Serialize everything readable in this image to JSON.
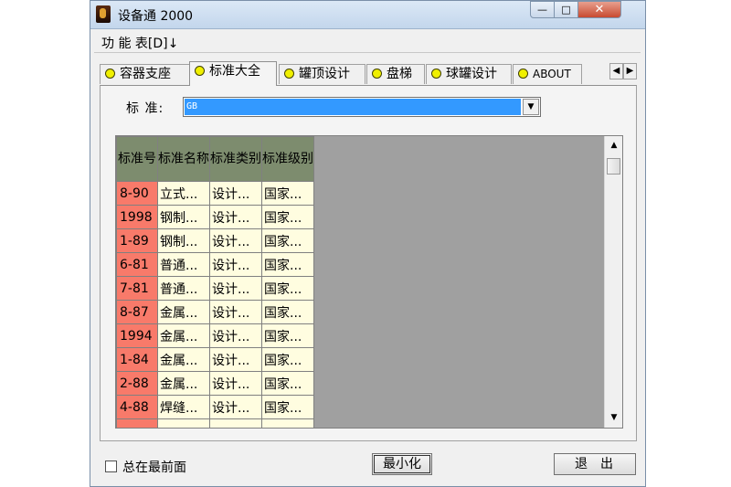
{
  "window": {
    "title": "设备通 2000"
  },
  "title_buttons": {
    "minimize": "—",
    "maximize": "□",
    "close": "✕"
  },
  "menu": {
    "function_table": "功 能 表[D]↓"
  },
  "tabs": [
    {
      "label": "容器支座",
      "active": false
    },
    {
      "label": "标准大全",
      "active": true
    },
    {
      "label": "罐顶设计",
      "active": false
    },
    {
      "label": "盘梯",
      "active": false
    },
    {
      "label": "球罐设计",
      "active": false
    },
    {
      "label": "ABOUT",
      "active": false
    }
  ],
  "tab_scroll": {
    "left": "◀",
    "right": "▶"
  },
  "standard": {
    "label": "标  准:",
    "selected": "GB",
    "dropdown_glyph": "▼"
  },
  "table": {
    "headers": [
      "标准号",
      "标准名称",
      "标准类别",
      "标准级别"
    ],
    "rows": [
      [
        "8-90",
        "立式...",
        "设计...",
        "国家..."
      ],
      [
        "1998",
        "钢制...",
        "设计...",
        "国家..."
      ],
      [
        "1-89",
        "钢制...",
        "设计...",
        "国家..."
      ],
      [
        "6-81",
        "普通...",
        "设计...",
        "国家..."
      ],
      [
        "7-81",
        "普通...",
        "设计...",
        "国家..."
      ],
      [
        "8-87",
        "金属...",
        "设计...",
        "国家..."
      ],
      [
        "1994",
        "金属...",
        "设计...",
        "国家..."
      ],
      [
        "1-84",
        "金属...",
        "设计...",
        "国家..."
      ],
      [
        "2-88",
        "金属...",
        "设计...",
        "国家..."
      ],
      [
        "4-88",
        "焊缝...",
        "设计...",
        "国家..."
      ]
    ]
  },
  "scrollbar": {
    "up": "▲",
    "down": "▼"
  },
  "footer": {
    "always_on_top": "总在最前面",
    "minimize": "最小化",
    "exit": "退出"
  },
  "colors": {
    "header_bg": "#7d8c6e",
    "number_bg": "#f87a6a",
    "cell_bg": "#fffde0",
    "selection": "#3399ff"
  }
}
